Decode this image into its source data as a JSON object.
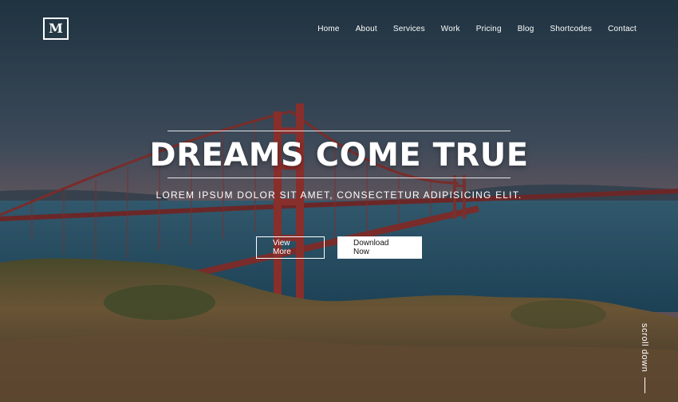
{
  "brand": {
    "logo_text": "M"
  },
  "nav": {
    "items": [
      {
        "label": "Home"
      },
      {
        "label": "About"
      },
      {
        "label": "Services"
      },
      {
        "label": "Work"
      },
      {
        "label": "Pricing"
      },
      {
        "label": "Blog"
      },
      {
        "label": "Shortcodes"
      },
      {
        "label": "Contact"
      }
    ]
  },
  "hero": {
    "title": "DREAMS COME TRUE",
    "subtitle": "LOREM IPSUM DOLOR SIT AMET, CONSECTETUR ADIPISICING ELIT.",
    "primary_button": "View More",
    "secondary_button": "Download Now"
  },
  "scroll": {
    "label": "scroll down"
  },
  "colors": {
    "overlay": "#1f3b48",
    "text": "#ffffff",
    "bridge": "#b5352d",
    "grass": "#a37a45",
    "water": "#2e6d88"
  }
}
